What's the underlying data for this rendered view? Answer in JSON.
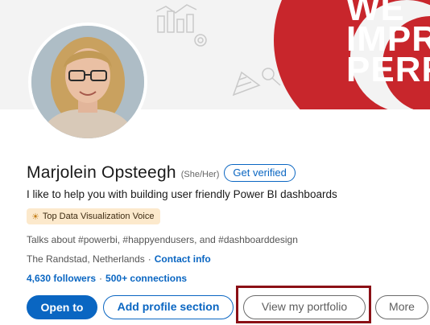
{
  "banner": {
    "text_lines": [
      "WE",
      "IMPRO",
      "PERFO"
    ],
    "accent_color": "#c8262c"
  },
  "profile": {
    "name": "Marjolein Opsteegh",
    "pronouns": "(She/Her)",
    "verify_label": "Get verified",
    "headline": "I like to help you with building user friendly Power BI dashboards",
    "badge_icon": "lightbulb-icon",
    "badge_label": "Top Data Visualization Voice",
    "talks_about": "Talks about #powerbi, #happyendusers, and #dashboarddesign",
    "location": "The Randstad, Netherlands",
    "location_separator": "·",
    "contact_label": "Contact info",
    "followers": "4,630 followers",
    "stats_separator": "·",
    "connections": "500+ connections"
  },
  "actions": {
    "open_to": "Open to",
    "add_section": "Add profile section",
    "portfolio": "View my portfolio",
    "more": "More"
  },
  "colors": {
    "brand_blue": "#0a66c2",
    "highlight_border": "#8b1016"
  }
}
